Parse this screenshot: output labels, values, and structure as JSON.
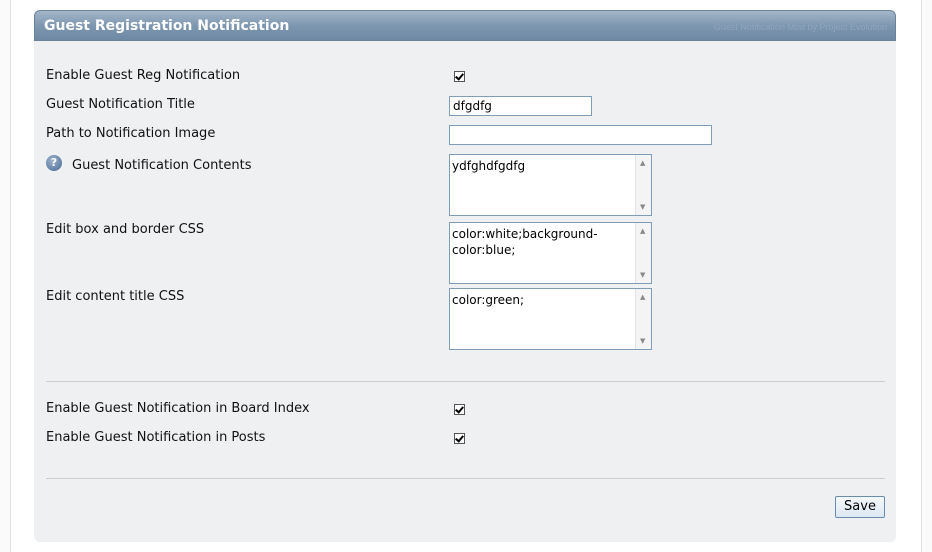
{
  "panel": {
    "title": "Guest Registration Notification",
    "credit": "Guest Notification Mod by Project Evolution"
  },
  "fields": {
    "enable_reg": {
      "label": "Enable Guest Reg Notification",
      "checked": true
    },
    "title": {
      "label": "Guest Notification Title",
      "value": "dfgdfg"
    },
    "image_path": {
      "label": "Path to Notification Image",
      "value": ""
    },
    "contents": {
      "label": "Guest Notification Contents",
      "value": "ydfghdfgdfg",
      "help_icon": "question-icon"
    },
    "box_css": {
      "label": "Edit box and border CSS",
      "value": "color:white;background-color:blue;"
    },
    "title_css": {
      "label": "Edit content title CSS",
      "value": "color:green;"
    },
    "enable_board_index": {
      "label": "Enable Guest Notification in Board Index",
      "checked": true
    },
    "enable_posts": {
      "label": "Enable Guest Notification in Posts",
      "checked": true
    }
  },
  "actions": {
    "save_label": "Save"
  },
  "colors": {
    "header": "#7e97b0",
    "panel_bg": "#eef0f2",
    "input_border": "#7f9db9"
  }
}
